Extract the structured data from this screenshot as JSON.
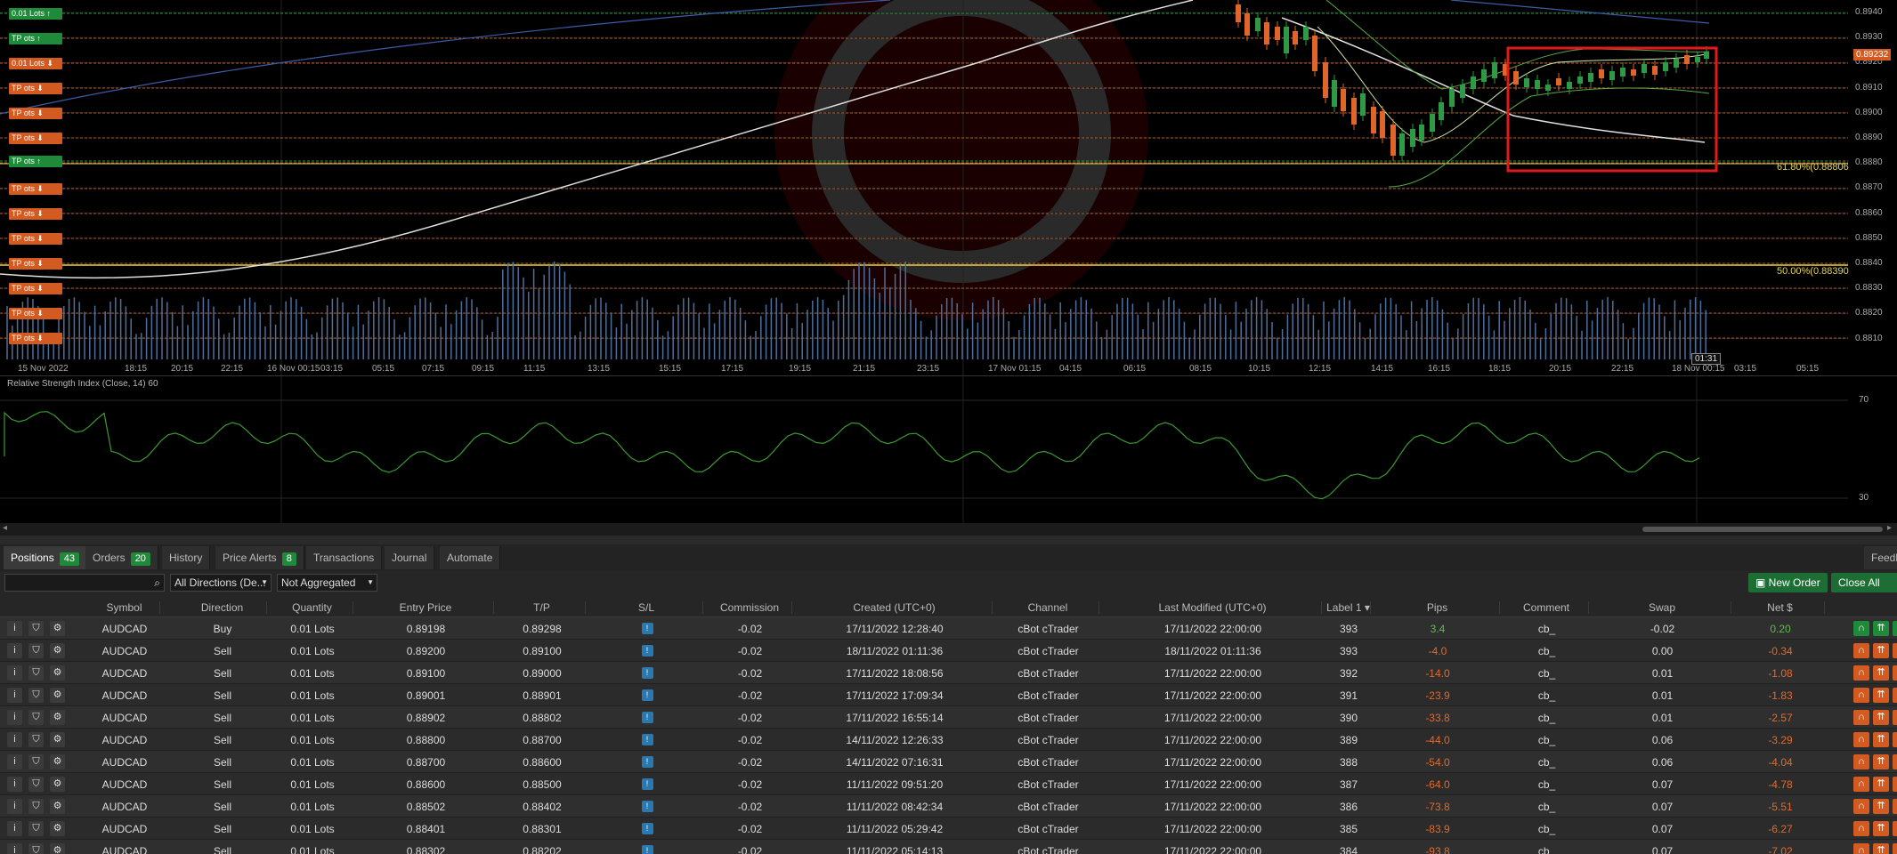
{
  "chart": {
    "price_ticks": [
      "0.8940",
      "0.8930",
      "0.8920",
      "0.8910",
      "0.8900",
      "0.8890",
      "0.8880",
      "0.8870",
      "0.8860",
      "0.8850",
      "0.8840",
      "0.8830",
      "0.8820",
      "0.8810"
    ],
    "time_ticks": [
      "15 Nov 2022",
      "18:15",
      "20:15",
      "22:15",
      "16 Nov 00:15",
      "03:15",
      "05:15",
      "07:15",
      "09:15",
      "11:15",
      "13:15",
      "15:15",
      "17:15",
      "19:15",
      "21:15",
      "23:15",
      "17 Nov 01:15",
      "04:15",
      "06:15",
      "08:15",
      "10:15",
      "12:15",
      "14:15",
      "16:15",
      "18:15",
      "20:15",
      "22:15",
      "18 Nov 00:15",
      "03:15",
      "05:15"
    ],
    "current_price": "0.89232",
    "time_cursor": "01:31",
    "fib_618": "61.80%(0.88806",
    "fib_500": "50.00%(0.88390",
    "buy_label": "0.01 Lots",
    "sell_label": "0.01 Lots",
    "tp_label": "TP",
    "lots_short": "ots",
    "colors": {
      "buy": "#1f8a3a",
      "sell": "#d35a20",
      "fib": "#e8d44a",
      "highlight": "#e01a1a"
    }
  },
  "rsi": {
    "title": "Relative Strength Index (Close, 14) 60",
    "level_70": "70",
    "level_30": "30"
  },
  "tabs": [
    {
      "label": "Positions",
      "count": "43"
    },
    {
      "label": "Orders",
      "count": "20"
    },
    {
      "label": "History",
      "count": ""
    },
    {
      "label": "Price Alerts",
      "count": "8"
    },
    {
      "label": "Transactions",
      "count": ""
    },
    {
      "label": "Journal",
      "count": ""
    },
    {
      "label": "Automate",
      "count": ""
    }
  ],
  "feedback": "Feedb",
  "toolbar": {
    "search_placeholder": "",
    "direction": "All Directions (De...",
    "aggregation": "Not Aggregated",
    "new_order": "New Order",
    "close_all": "Close All Posi"
  },
  "columns": [
    "Symbol",
    "Direction",
    "Quantity",
    "Entry Price",
    "T/P",
    "S/L",
    "Commission",
    "Created (UTC+0)",
    "Channel",
    "Last Modified (UTC+0)",
    "Label",
    "Pips",
    "Comment",
    "Swap",
    "Net $"
  ],
  "label_sort_badge": "1",
  "rows": [
    {
      "symbol": "AUDCAD",
      "direction": "Buy",
      "quantity": "0.01 Lots",
      "entry": "0.89198",
      "tp": "0.89298",
      "commission": "-0.02",
      "created": "17/11/2022 12:28:40",
      "channel": "cBot cTrader",
      "modified": "17/11/2022 22:00:00",
      "label": "393",
      "pips": "3.4",
      "comment": "cb_",
      "swap": "-0.02",
      "net": "0.20"
    },
    {
      "symbol": "AUDCAD",
      "direction": "Sell",
      "quantity": "0.01 Lots",
      "entry": "0.89200",
      "tp": "0.89100",
      "commission": "-0.02",
      "created": "18/11/2022 01:11:36",
      "channel": "cBot cTrader",
      "modified": "18/11/2022 01:11:36",
      "label": "393",
      "pips": "-4.0",
      "comment": "cb_",
      "swap": "0.00",
      "net": "-0.34"
    },
    {
      "symbol": "AUDCAD",
      "direction": "Sell",
      "quantity": "0.01 Lots",
      "entry": "0.89100",
      "tp": "0.89000",
      "commission": "-0.02",
      "created": "17/11/2022 18:08:56",
      "channel": "cBot cTrader",
      "modified": "17/11/2022 22:00:00",
      "label": "392",
      "pips": "-14.0",
      "comment": "cb_",
      "swap": "0.01",
      "net": "-1.08"
    },
    {
      "symbol": "AUDCAD",
      "direction": "Sell",
      "quantity": "0.01 Lots",
      "entry": "0.89001",
      "tp": "0.88901",
      "commission": "-0.02",
      "created": "17/11/2022 17:09:34",
      "channel": "cBot cTrader",
      "modified": "17/11/2022 22:00:00",
      "label": "391",
      "pips": "-23.9",
      "comment": "cb_",
      "swap": "0.01",
      "net": "-1.83"
    },
    {
      "symbol": "AUDCAD",
      "direction": "Sell",
      "quantity": "0.01 Lots",
      "entry": "0.88902",
      "tp": "0.88802",
      "commission": "-0.02",
      "created": "17/11/2022 16:55:14",
      "channel": "cBot cTrader",
      "modified": "17/11/2022 22:00:00",
      "label": "390",
      "pips": "-33.8",
      "comment": "cb_",
      "swap": "0.01",
      "net": "-2.57"
    },
    {
      "symbol": "AUDCAD",
      "direction": "Sell",
      "quantity": "0.01 Lots",
      "entry": "0.88800",
      "tp": "0.88700",
      "commission": "-0.02",
      "created": "14/11/2022 12:26:33",
      "channel": "cBot cTrader",
      "modified": "17/11/2022 22:00:00",
      "label": "389",
      "pips": "-44.0",
      "comment": "cb_",
      "swap": "0.06",
      "net": "-3.29"
    },
    {
      "symbol": "AUDCAD",
      "direction": "Sell",
      "quantity": "0.01 Lots",
      "entry": "0.88700",
      "tp": "0.88600",
      "commission": "-0.02",
      "created": "14/11/2022 07:16:31",
      "channel": "cBot cTrader",
      "modified": "17/11/2022 22:00:00",
      "label": "388",
      "pips": "-54.0",
      "comment": "cb_",
      "swap": "0.06",
      "net": "-4.04"
    },
    {
      "symbol": "AUDCAD",
      "direction": "Sell",
      "quantity": "0.01 Lots",
      "entry": "0.88600",
      "tp": "0.88500",
      "commission": "-0.02",
      "created": "11/11/2022 09:51:20",
      "channel": "cBot cTrader",
      "modified": "17/11/2022 22:00:00",
      "label": "387",
      "pips": "-64.0",
      "comment": "cb_",
      "swap": "0.07",
      "net": "-4.78"
    },
    {
      "symbol": "AUDCAD",
      "direction": "Sell",
      "quantity": "0.01 Lots",
      "entry": "0.88502",
      "tp": "0.88402",
      "commission": "-0.02",
      "created": "11/11/2022 08:42:34",
      "channel": "cBot cTrader",
      "modified": "17/11/2022 22:00:00",
      "label": "386",
      "pips": "-73.8",
      "comment": "cb_",
      "swap": "0.07",
      "net": "-5.51"
    },
    {
      "symbol": "AUDCAD",
      "direction": "Sell",
      "quantity": "0.01 Lots",
      "entry": "0.88401",
      "tp": "0.88301",
      "commission": "-0.02",
      "created": "11/11/2022 05:29:42",
      "channel": "cBot cTrader",
      "modified": "17/11/2022 22:00:00",
      "label": "385",
      "pips": "-83.9",
      "comment": "cb_",
      "swap": "0.07",
      "net": "-6.27"
    },
    {
      "symbol": "AUDCAD",
      "direction": "Sell",
      "quantity": "0.01 Lots",
      "entry": "0.88302",
      "tp": "0.88202",
      "commission": "-0.02",
      "created": "11/11/2022 05:14:13",
      "channel": "cBot cTrader",
      "modified": "17/11/2022 22:00:00",
      "label": "384",
      "pips": "-93.8",
      "comment": "cb_",
      "swap": "0.07",
      "net": "-7.02"
    }
  ]
}
